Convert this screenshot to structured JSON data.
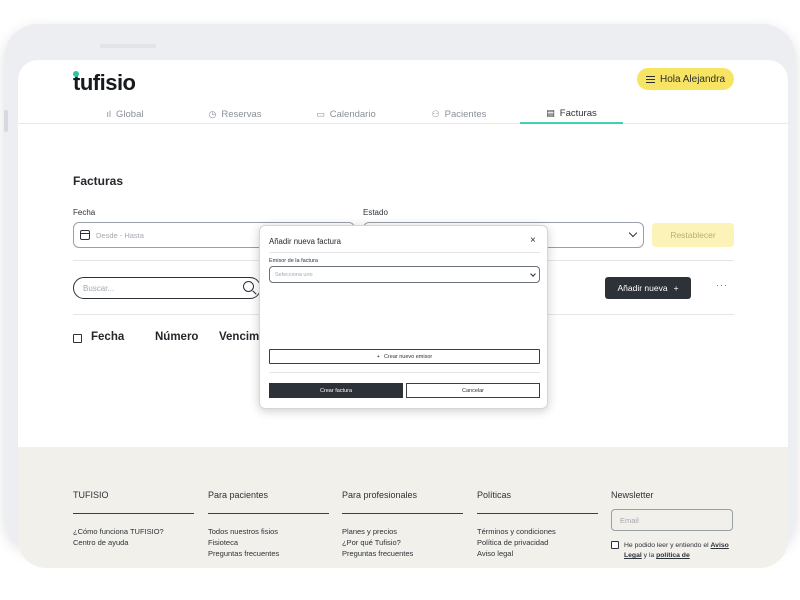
{
  "header": {
    "logo": "tufisio",
    "greeting_button": "Hola Alejandra"
  },
  "tabs": [
    {
      "label": "Global",
      "icon": "ıl"
    },
    {
      "label": "Reservas",
      "icon": "◷"
    },
    {
      "label": "Calendario",
      "icon": "▭"
    },
    {
      "label": "Pacientes",
      "icon": "⚇"
    },
    {
      "label": "Facturas",
      "icon": "▤",
      "active": true
    }
  ],
  "page": {
    "title": "Facturas",
    "fecha_label": "Fecha",
    "fecha_placeholder": "Desde - Hasta",
    "estado_label": "Estado",
    "reset_button": "Restablecer",
    "search_placeholder": "Buscar...",
    "add_button": "Añadir nueva",
    "add_icon": "+",
    "more": "···",
    "columns": [
      "Fecha",
      "Número",
      "Vencim"
    ]
  },
  "modal": {
    "title": "Añadir nueva factura",
    "close": "×",
    "emisor_label": "Emisor de la factura",
    "emisor_placeholder": "Selecciona uno",
    "create_emisor": "Crear nuevo emisor",
    "create_emisor_icon": "+",
    "primary_button": "Crear factura",
    "secondary_button": "Cancelar"
  },
  "footer": {
    "columns": [
      {
        "title": "TUFISIO",
        "links": [
          "¿Cómo funciona TUFISIO?",
          "Centro de ayuda"
        ]
      },
      {
        "title": "Para pacientes",
        "links": [
          "Todos nuestros fisios",
          "Fisioteca",
          "Preguntas frecuentes"
        ]
      },
      {
        "title": "Para profesionales",
        "links": [
          "Planes y precios",
          "¿Por qué Tufisio?",
          "Preguntas frecuentes"
        ]
      },
      {
        "title": "Políticas",
        "links": [
          "Términos y condiciones",
          "Política de privacidad",
          "Aviso legal"
        ]
      }
    ],
    "newsletter": {
      "title": "Newsletter",
      "email_placeholder": "Email",
      "consent_prefix": "He podido leer y entiendo el ",
      "consent_link1": "Aviso Legal",
      "consent_mid": " y la ",
      "consent_link2": "política de"
    }
  },
  "colors": {
    "accent_teal": "#3ed1b2",
    "accent_yellow": "#f7e463",
    "dark": "#2d3138",
    "footer_bg": "#f2f0eb"
  }
}
